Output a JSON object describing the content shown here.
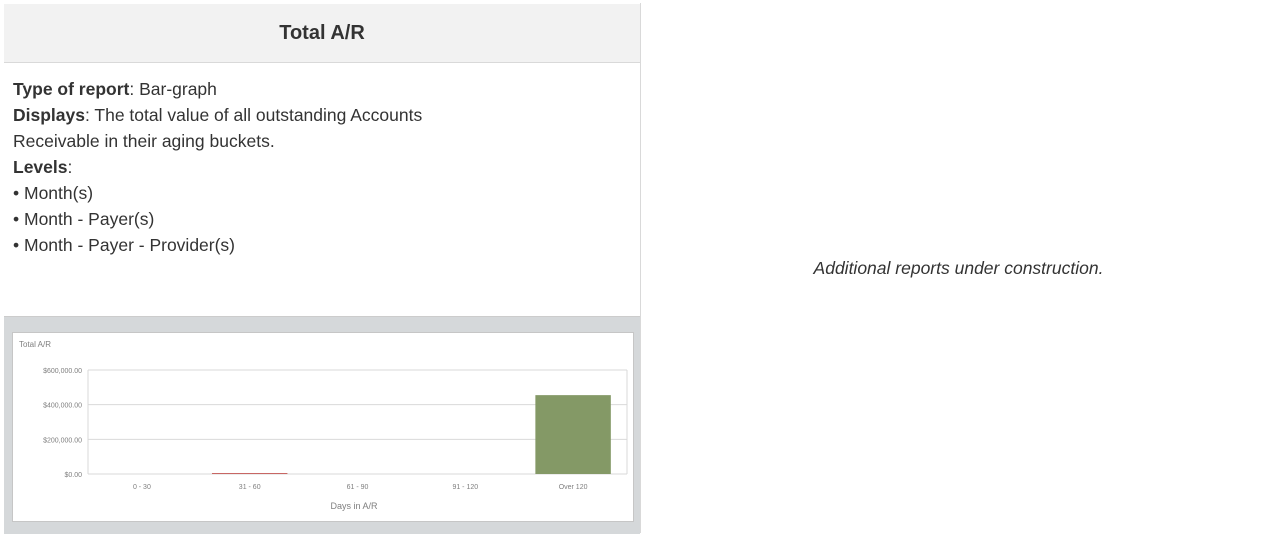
{
  "card": {
    "title": "Total A/R",
    "type_label": "Type of report",
    "type_value": ": Bar-graph",
    "displays_label": "Displays",
    "displays_value_line1": ": The total value of all outstanding Accounts",
    "displays_value_line2": "Receivable in their aging buckets.",
    "levels_label": "Levels",
    "levels_colon": ":",
    "levels": [
      "• Month(s)",
      "• Month - Payer(s)",
      "• Month - Payer - Provider(s)"
    ]
  },
  "right_panel": {
    "message": "Additional reports under construction."
  },
  "chart_data": {
    "type": "bar",
    "title": "Total A/R",
    "xlabel": "Days in A/R",
    "ylabel": "",
    "categories": [
      "0 - 30",
      "31 - 60",
      "61 - 90",
      "91 - 120",
      "Over 120"
    ],
    "values": [
      0,
      5000,
      0,
      0,
      455000
    ],
    "bar_colors": [
      "#c0504d",
      "#c0504d",
      "#4f81bd",
      "#8064a2",
      "#849966"
    ],
    "ylim": [
      0,
      600000
    ],
    "yticks": [
      0,
      200000,
      400000,
      600000
    ],
    "ytick_labels": [
      "$0.00",
      "$200,000.00",
      "$400,000.00",
      "$600,000.00"
    ],
    "grid": true,
    "legend": "none"
  }
}
